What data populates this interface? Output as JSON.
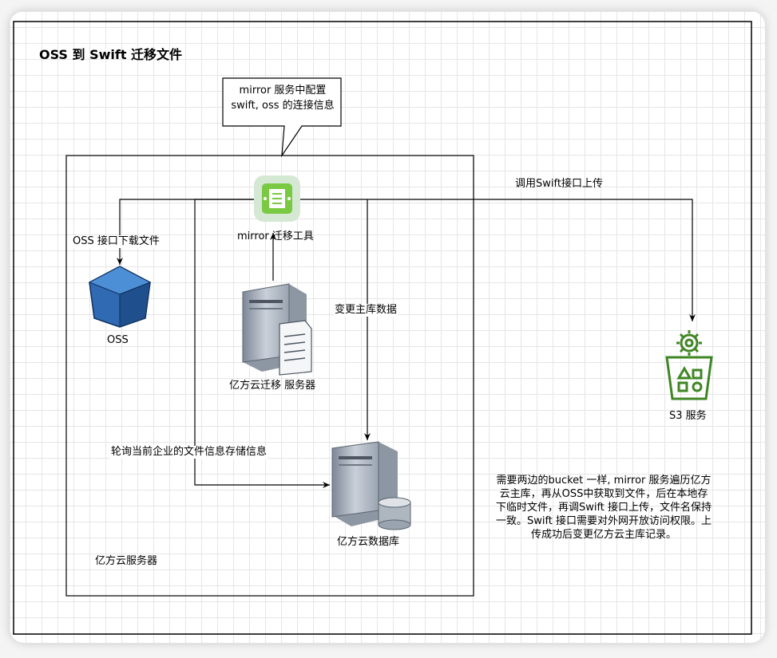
{
  "title": "OSS 到 Swift 迁移文件",
  "callout": "mirror 服务中配置 swift, oss 的连接信息",
  "nodes": {
    "mirror_tool": "mirror 迁移工具",
    "oss": "OSS",
    "migration_server": "亿方云迁移 服务器",
    "database": "亿方云数据库",
    "s3": "S3 服务",
    "yifang_group": "亿方云服务器"
  },
  "edges": {
    "oss_download": "OSS 接口下载文件",
    "swift_upload": "调用Swift接口上传",
    "change_db": "变更主库数据",
    "poll": "轮询当前企业的文件信息存储信息"
  },
  "note": "需要两边的bucket 一样, mirror 服务遍历亿方云主库，再从OSS中获取到文件，后在本地存下临时文件，再调Swift 接口上传，文件名保持一致。Swift 接口需要对外网开放访问权限。上传成功后变更亿方云主库记录。",
  "colors": {
    "mirror_fill": "#d5e8d4",
    "mirror_icon": "#7ac943",
    "oss_blue": "#2f6ab3",
    "s3_green": "#3f8624"
  }
}
